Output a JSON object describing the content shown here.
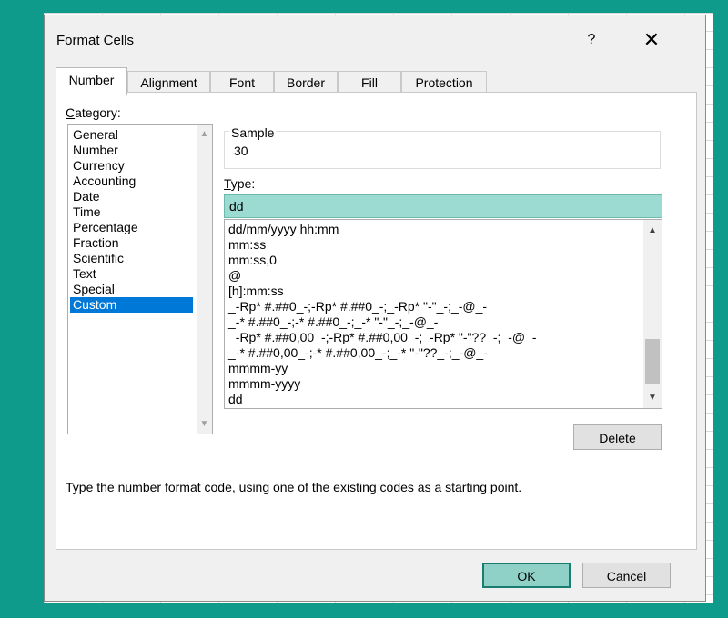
{
  "dialog": {
    "title": "Format Cells",
    "help": "?",
    "close": "✕"
  },
  "tabs": [
    {
      "label": "Number"
    },
    {
      "label": "Alignment"
    },
    {
      "label": "Font"
    },
    {
      "label": "Border"
    },
    {
      "label": "Fill"
    },
    {
      "label": "Protection"
    }
  ],
  "category": {
    "label": "Category:",
    "items": [
      "General",
      "Number",
      "Currency",
      "Accounting",
      "Date",
      "Time",
      "Percentage",
      "Fraction",
      "Scientific",
      "Text",
      "Special",
      "Custom"
    ],
    "selected": "Custom"
  },
  "sample": {
    "label": "Sample",
    "value": "30"
  },
  "type": {
    "label": "Type:",
    "value": "dd",
    "items": [
      "dd/mm/yyyy hh:mm",
      "mm:ss",
      "mm:ss,0",
      "@",
      "[h]:mm:ss",
      "_-Rp* #.##0_-;-Rp* #.##0_-;_-Rp* \"-\"_-;_-@_-",
      "_-* #.##0_-;-* #.##0_-;_-* \"-\"_-;_-@_-",
      "_-Rp* #.##0,00_-;-Rp* #.##0,00_-;_-Rp* \"-\"??_-;_-@_-",
      "_-* #.##0,00_-;-* #.##0,00_-;_-* \"-\"??_-;_-@_-",
      "mmmm-yy",
      "mmmm-yyyy",
      "dd"
    ]
  },
  "buttons": {
    "delete": "Delete",
    "ok": "OK",
    "cancel": "Cancel"
  },
  "hint": "Type the number format code, using one of the existing codes as a starting point.",
  "colors": {
    "background": "#0e9b8c",
    "selection": "#0078d7",
    "type_input": "#9bdbd2",
    "ok_button": "#8fd1c7"
  },
  "icons": {
    "help": "question-icon",
    "close": "close-icon",
    "scroll_up": "chevron-up-icon",
    "scroll_down": "chevron-down-icon"
  }
}
